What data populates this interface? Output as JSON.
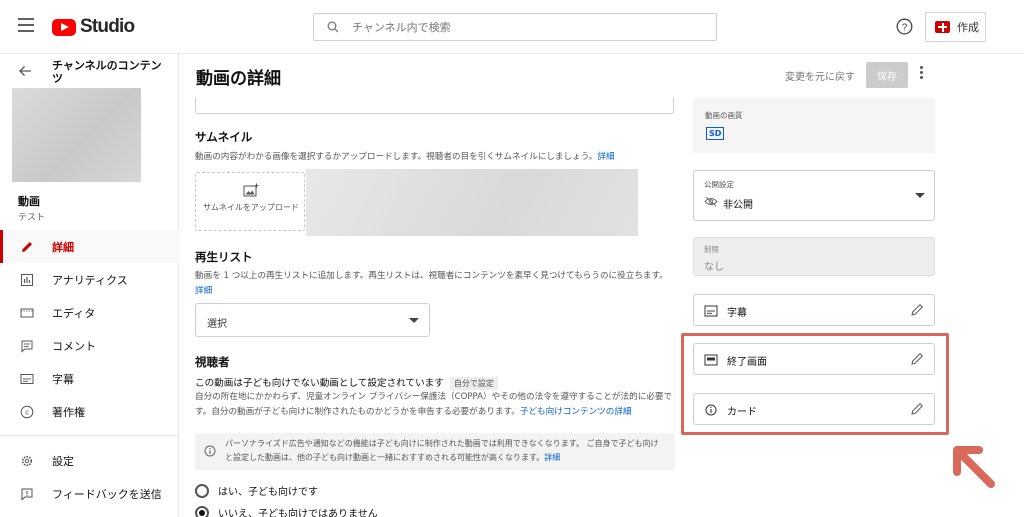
{
  "topbar": {
    "logo_text": "Studio",
    "search_placeholder": "チャンネル内で検索",
    "create_label": "作成"
  },
  "sidebar": {
    "channel_title": "チャンネルのコンテンツ",
    "video_label": "動画",
    "video_sub": "テスト",
    "items": [
      {
        "label": "詳細",
        "icon": "pencil-icon",
        "active": true
      },
      {
        "label": "アナリティクス",
        "icon": "analytics-icon"
      },
      {
        "label": "エディタ",
        "icon": "editor-icon"
      },
      {
        "label": "コメント",
        "icon": "comment-icon"
      },
      {
        "label": "字幕",
        "icon": "subtitles-icon"
      },
      {
        "label": "著作権",
        "icon": "copyright-icon"
      }
    ],
    "bottom_items": [
      {
        "label": "設定",
        "icon": "gear-icon"
      },
      {
        "label": "フィードバックを送信",
        "icon": "feedback-icon"
      }
    ]
  },
  "header": {
    "title": "動画の詳細",
    "undo_label": "変更を元に戻す",
    "save_label": "保存"
  },
  "thumbnail": {
    "title": "サムネイル",
    "desc": "動画の内容がわかる画像を選択するかアップロードします。視聴者の目を引くサムネイルにしましょう。",
    "link": "詳細",
    "upload_label": "サムネイルをアップロード"
  },
  "playlist": {
    "title": "再生リスト",
    "desc": "動画を 1 つ以上の再生リストに追加します。再生リストは、視聴者にコンテンツを素早く見つけてもらうのに役立ちます。",
    "link": "詳細",
    "select_value": "選択"
  },
  "audience": {
    "title": "視聴者",
    "setting": "この動画は子ども向けでない動画として設定されています",
    "badge": "自分で設定",
    "desc": "自分の所在地にかかわらず、児童オンライン プライバシー保護法（COPPA）やその他の法令を遵守することが法的に必要です。自分の動画が子ども向けに制作されたものかどうかを申告する必要があります。",
    "link": "子ども向けコンテンツの詳細",
    "info": "パーソナライズド広告や通知などの機能は子ども向けに制作された動画では利用できなくなります。 ご自身で子ども向けと設定した動画は、他の子ども向け動画と一緒におすすめされる可能性が高くなります。",
    "info_link": "詳細",
    "option_yes": "はい、子ども向けです",
    "option_no": "いいえ、子ども向けではありません",
    "selected": "no"
  },
  "right_panel": {
    "quality_label": "動画の画質",
    "quality_badge": "SD",
    "visibility_label": "公開設定",
    "visibility_value": "非公開",
    "restriction_label": "制限",
    "restriction_value": "なし",
    "subtitles_label": "字幕",
    "end_screen_label": "終了画面",
    "cards_label": "カード"
  },
  "colors": {
    "accent": "#cc0000",
    "link": "#065fd4",
    "highlight": "#d9695b"
  }
}
